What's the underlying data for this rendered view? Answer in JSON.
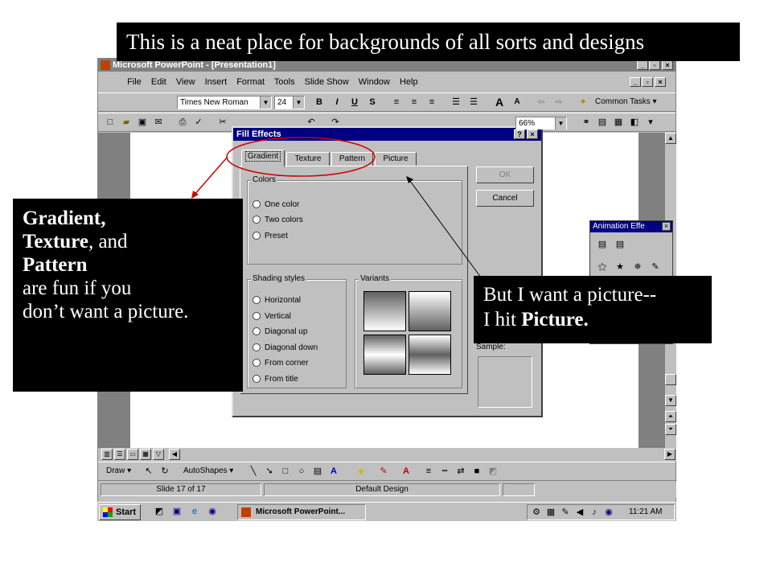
{
  "banner": {
    "text": "This is a neat place for backgrounds of all sorts and designs"
  },
  "left_callout": {
    "line1_bold": "Gradient,",
    "line2_bold": "Texture",
    "line2_rest": ", and",
    "line3_bold": "Pattern",
    "line4": "are fun if you",
    "line5": "don’t want a picture."
  },
  "right_callout": {
    "line1": "But I want a picture--",
    "line2_prefix": "I hit ",
    "line2_bold": "Picture."
  },
  "app": {
    "title": "Microsoft PowerPoint - [Presentation1]",
    "menu": [
      "File",
      "Edit",
      "View",
      "Insert",
      "Format",
      "Tools",
      "Slide Show",
      "Window",
      "Help"
    ],
    "font_name": "Times New Roman",
    "font_size": "24",
    "zoom": "66%",
    "common_tasks": "Common Tasks ▾",
    "draw_label": "Draw ▾",
    "autoshapes_label": "AutoShapes ▾",
    "status_slide": "Slide 17 of 17",
    "status_design": "Default Design"
  },
  "dialog": {
    "title": "Fill Effects",
    "tabs": [
      "Gradient",
      "Texture",
      "Pattern",
      "Picture"
    ],
    "ok": "OK",
    "cancel": "Cancel",
    "colors_label": "Colors",
    "color_options": [
      "One color",
      "Two colors",
      "Preset"
    ],
    "shading_label": "Shading styles",
    "shading_options": [
      "Horizontal",
      "Vertical",
      "Diagonal up",
      "Diagonal down",
      "From corner",
      "From title"
    ],
    "variants_label": "Variants",
    "sample_label": "Sample:"
  },
  "anim_panel": {
    "title": "Animation Effe"
  },
  "taskbar": {
    "start": "Start",
    "task": "Microsoft PowerPoint...",
    "clock": "11:21 AM"
  },
  "colors": {
    "dialog_title": "#000080",
    "callout_bg": "#000000",
    "annotation": "#cc0000"
  }
}
